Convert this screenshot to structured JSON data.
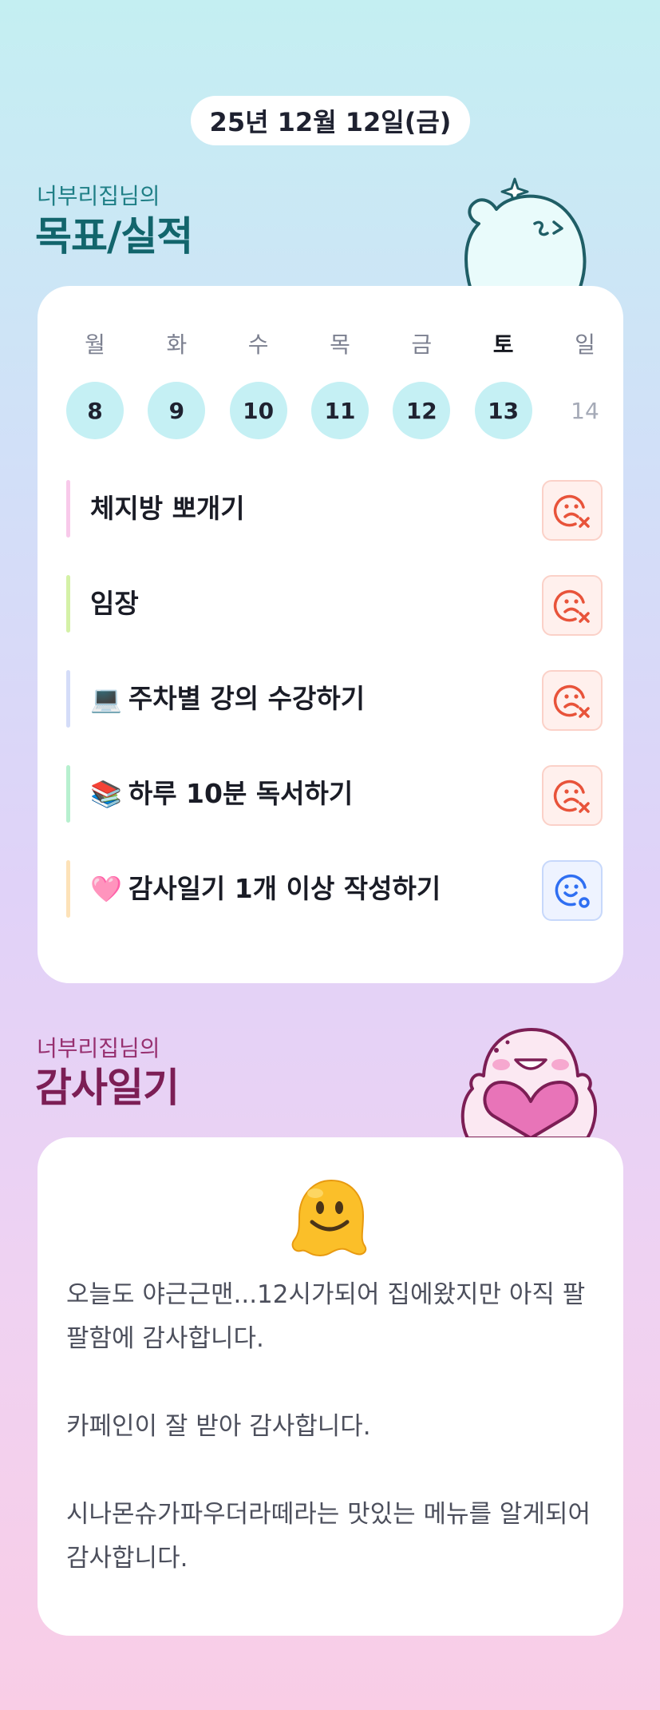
{
  "header": {
    "date": "25년 12월 12일(금)"
  },
  "goals_section": {
    "subtitle": "너부리집님의",
    "title": "목표/실적",
    "week": [
      {
        "day": "월",
        "date": "8",
        "done": true
      },
      {
        "day": "화",
        "date": "9",
        "done": true
      },
      {
        "day": "수",
        "date": "10",
        "done": true
      },
      {
        "day": "목",
        "date": "11",
        "done": true
      },
      {
        "day": "금",
        "date": "12",
        "done": true
      },
      {
        "day": "토",
        "date": "13",
        "done": true
      },
      {
        "day": "일",
        "date": "14",
        "done": false
      }
    ],
    "goals": [
      {
        "emoji": "",
        "label": "체지방 뽀개기",
        "color": "#f8c9ea",
        "status": "fail"
      },
      {
        "emoji": "",
        "label": "임장",
        "color": "#d4f1a7",
        "status": "fail"
      },
      {
        "emoji": "💻",
        "label": "주차별 강의 수강하기",
        "color": "#d4dcf8",
        "status": "fail"
      },
      {
        "emoji": "📚",
        "label": "하루 10분 독서하기",
        "color": "#b7f0cf",
        "status": "fail"
      },
      {
        "emoji": "🩷",
        "label": "감사일기 1개 이상 작성하기",
        "color": "#fde2b8",
        "status": "done"
      }
    ],
    "status_colors": {
      "fail": "#e8533a",
      "done": "#2f6ff2"
    }
  },
  "gratitude_section": {
    "subtitle": "너부리집님의",
    "title": "감사일기",
    "mood_icon": "melting-face-icon",
    "text": "오늘도 야근근맨...12시가되어 집에왔지만 아직 팔팔함에 감사합니다.\n\n카페인이 잘 받아 감사합니다.\n\n시나몬슈가파우더라떼라는 맛있는 메뉴를 알게되어 감사합니다."
  }
}
